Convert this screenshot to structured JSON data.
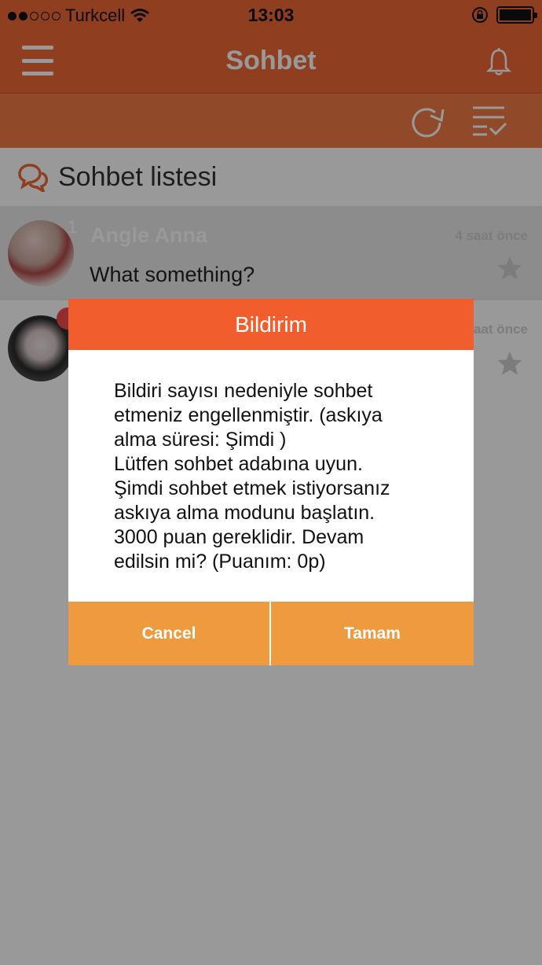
{
  "status_bar": {
    "carrier": "Turkcell",
    "time": "13:03",
    "icons": [
      "signal-dots-icon",
      "wifi-icon",
      "rotation-lock-icon",
      "battery-icon"
    ]
  },
  "navbar": {
    "title": "Sohbet",
    "icons": [
      "menu-icon",
      "bell-icon"
    ]
  },
  "toolbar": {
    "icons": [
      "refresh-icon",
      "filter-list-icon"
    ]
  },
  "section": {
    "title": "Sohbet listesi",
    "icon": "chat-bubbles-icon"
  },
  "chats": [
    {
      "name": "Angle Anna",
      "message": "What something?",
      "time": "4 saat önce",
      "unread": "1",
      "icon": "star-icon"
    },
    {
      "name": "",
      "message": "",
      "time": "aat önce",
      "icon": "star-icon"
    }
  ],
  "dialog": {
    "title": "Bildirim",
    "lines": [
      "Bildiri sayısı nedeniyle sohbet",
      "etmeniz engellenmiştir. (askıya",
      "alma süresi: Şimdi )",
      "Lütfen sohbet adabına uyun.",
      "Şimdi sohbet etmek istiyorsanız",
      "askıya alma modunu başlatın.",
      "3000 puan gereklidir. Devam",
      "edilsin mi? (Puanım: 0p)"
    ],
    "cancel_label": "Cancel",
    "ok_label": "Tamam"
  },
  "colors": {
    "primary": "#ef6a35",
    "dialog_header": "#f25d2d",
    "dialog_button": "#ee9a3e",
    "badge": "#f24b4b"
  }
}
